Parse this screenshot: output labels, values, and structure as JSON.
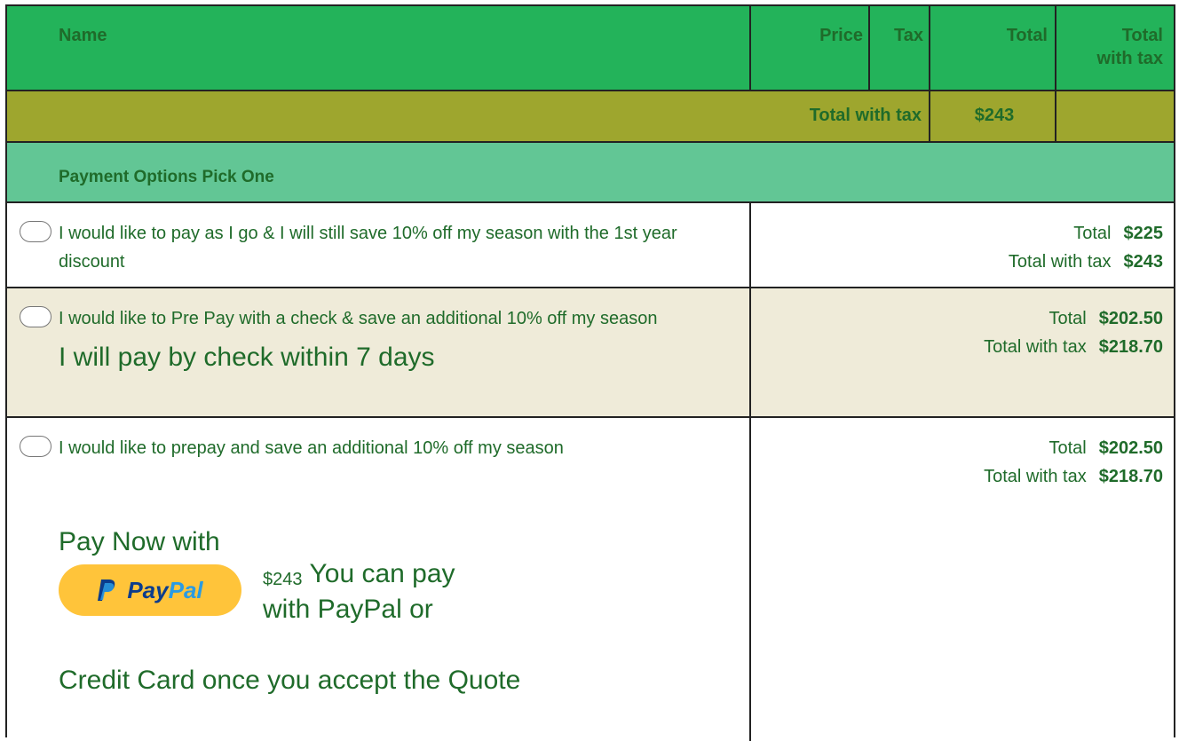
{
  "table": {
    "headers": {
      "name": "Name",
      "price": "Price",
      "tax": "Tax",
      "total": "Total",
      "total_with_tax_line1": "Total",
      "total_with_tax_line2": "with tax"
    },
    "summary": {
      "label": "Total with tax",
      "value": "$243"
    }
  },
  "payment": {
    "heading": "Payment Options Pick One",
    "options": [
      {
        "text": "I would like to pay as I go & I will still save 10% off my season with the 1st year discount",
        "total_label": "Total",
        "total": "$225",
        "total_with_tax_label": "Total with tax",
        "total_with_tax": "$243"
      },
      {
        "text": "I would like to Pre Pay with a check & save an additional 10% off my season",
        "note": "I will pay by check within 7 days",
        "total_label": "Total",
        "total": "$202.50",
        "total_with_tax_label": "Total with tax",
        "total_with_tax": "$218.70"
      },
      {
        "text": "I would like to prepay and save an additional 10% off my season",
        "pay_now": "Pay Now with",
        "paypal_word1": "Pay",
        "paypal_word2": "Pal",
        "paypal_amount": "$243",
        "paypal_msg_a": "You can pay",
        "paypal_msg_b": "with PayPal or",
        "paypal_msg_c": "Credit Card once you accept the Quote",
        "total_label": "Total",
        "total": "$202.50",
        "total_with_tax_label": "Total with tax",
        "total_with_tax": "$218.70"
      }
    ]
  },
  "colors": {
    "header_green": "#23b35a",
    "olive": "#9ea62e",
    "mint": "#62c695",
    "beige": "#efebd9",
    "text_green": "#1f6b2a",
    "paypal_yellow": "#ffc43a"
  }
}
